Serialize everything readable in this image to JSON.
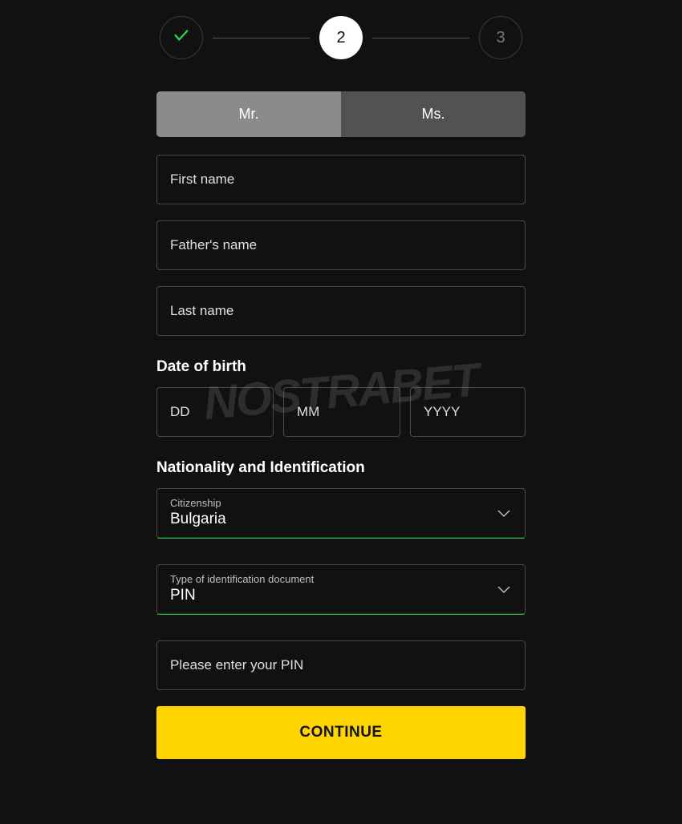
{
  "stepper": {
    "step1_done": true,
    "step2_label": "2",
    "step3_label": "3"
  },
  "title_toggle": {
    "mr": "Mr.",
    "ms": "Ms.",
    "selected": "mr"
  },
  "fields": {
    "first_name_placeholder": "First name",
    "fathers_name_placeholder": "Father's name",
    "last_name_placeholder": "Last name"
  },
  "dob": {
    "label": "Date of birth",
    "dd_placeholder": "DD",
    "mm_placeholder": "MM",
    "yyyy_placeholder": "YYYY"
  },
  "nationality": {
    "section_label": "Nationality and Identification",
    "citizenship_label": "Citizenship",
    "citizenship_value": "Bulgaria",
    "doc_type_label": "Type of identification document",
    "doc_type_value": "PIN",
    "pin_placeholder": "Please enter your PIN"
  },
  "continue_label": "CONTINUE",
  "watermark": "NOSTRABET"
}
